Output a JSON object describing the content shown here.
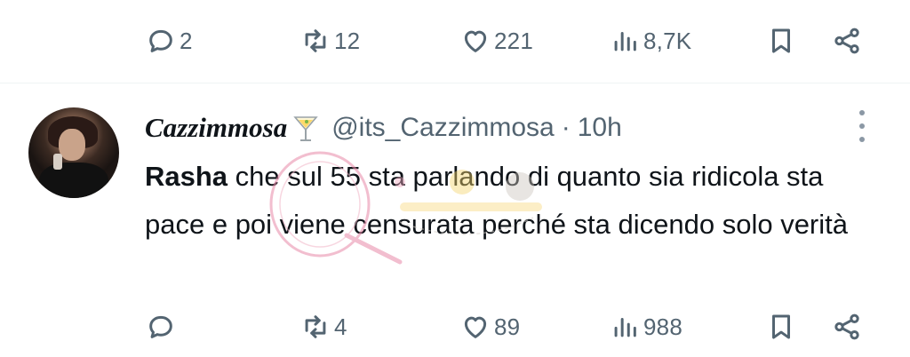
{
  "top_actions": {
    "replies": "2",
    "retweets": "12",
    "likes": "221",
    "views": "8,7K"
  },
  "tweet": {
    "display_name": "Cazzimmosa",
    "name_emoji": "cocktail-glass",
    "handle": "@its_Cazzimmosa",
    "separator": "·",
    "time": "10h",
    "mention": "Rasha",
    "text": " che sul 55 sta parlando di quanto sia ridicola sta pace e poi viene censurata perché sta dicendo solo verità"
  },
  "bottom_actions": {
    "replies": "",
    "retweets": "4",
    "likes": "89",
    "views": "988"
  },
  "icons": {
    "reply": "speech-bubble-icon",
    "retweet": "retweet-icon",
    "like": "heart-icon",
    "views": "bar-chart-icon",
    "bookmark": "bookmark-icon",
    "share": "share-icon",
    "more": "three-dots-icon"
  },
  "colors": {
    "text_primary": "#0f1419",
    "text_secondary": "#536471",
    "divider": "#eff3f4"
  }
}
